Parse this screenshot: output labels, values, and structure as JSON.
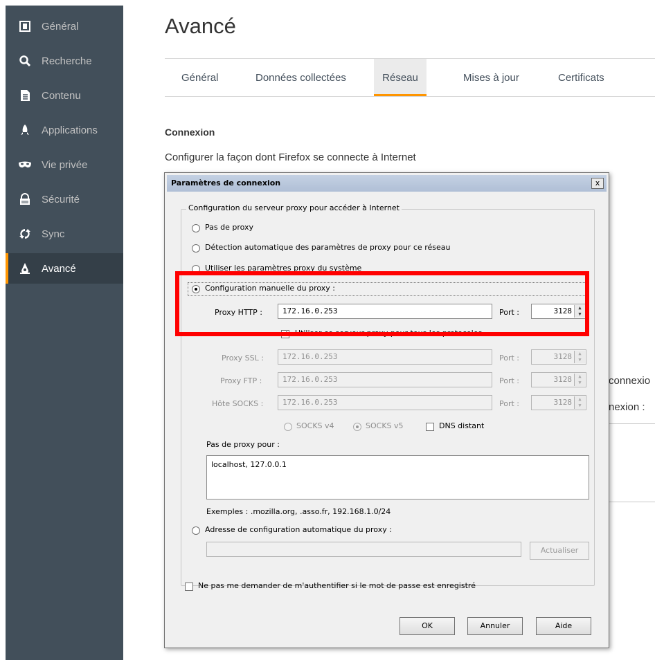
{
  "sidebar": {
    "items": [
      {
        "label": "Général",
        "icon": "general-icon"
      },
      {
        "label": "Recherche",
        "icon": "search-icon"
      },
      {
        "label": "Contenu",
        "icon": "content-icon"
      },
      {
        "label": "Applications",
        "icon": "applications-icon"
      },
      {
        "label": "Vie privée",
        "icon": "privacy-mask-icon"
      },
      {
        "label": "Sécurité",
        "icon": "security-lock-icon"
      },
      {
        "label": "Sync",
        "icon": "sync-icon"
      },
      {
        "label": "Avancé",
        "icon": "advanced-icon",
        "active": true
      }
    ]
  },
  "page": {
    "title": "Avancé",
    "tabs": [
      "Général",
      "Données collectées",
      "Réseau",
      "Mises à jour",
      "Certificats"
    ],
    "selected_tab": "Réseau",
    "section_title": "Connexion",
    "section_desc": "Configurer la façon dont Firefox se connecte à Internet",
    "bg_text_1": "connexio",
    "bg_text_2": "nexion :"
  },
  "dialog": {
    "title": "Paramètres de connexion",
    "close": "x",
    "group_label": "Configuration du serveur proxy pour accéder à Internet",
    "radio_no_proxy": "Pas de proxy",
    "radio_auto_detect": "Détection automatique des paramètres de proxy pour ce réseau",
    "radio_system": "Utiliser les paramètres proxy du système",
    "radio_manual": "Configuration manuelle du proxy :",
    "http_label": "Proxy HTTP :",
    "http_value": "172.16.0.253",
    "port_label": "Port :",
    "http_port": "3128",
    "use_for_all": "Utiliser ce serveur proxy pour tous les protocoles",
    "ssl_label": "Proxy SSL :",
    "ssl_value": "172.16.0.253",
    "ssl_port": "3128",
    "ftp_label": "Proxy FTP :",
    "ftp_value": "172.16.0.253",
    "ftp_port": "3128",
    "socks_label": "Hôte SOCKS :",
    "socks_value": "172.16.0.253",
    "socks_port": "3128",
    "socks_v4": "SOCKS v4",
    "socks_v5": "SOCKS v5",
    "dns_remote": "DNS distant",
    "no_proxy_label": "Pas de proxy pour :",
    "no_proxy_value": "localhost, 127.0.0.1",
    "examples": "Exemples : .mozilla.org, .asso.fr, 192.168.1.0/24",
    "radio_pac": "Adresse de configuration automatique du proxy :",
    "pac_value": "",
    "reload_button": "Actualiser",
    "no_auth_prompt": "Ne pas me demander de m'authentifier si le mot de passe est enregistré",
    "ok": "OK",
    "cancel": "Annuler",
    "help": "Aide"
  },
  "colors": {
    "sidebar_bg": "#424f5a",
    "accent": "#ff9500",
    "highlight": "#ff0000"
  }
}
